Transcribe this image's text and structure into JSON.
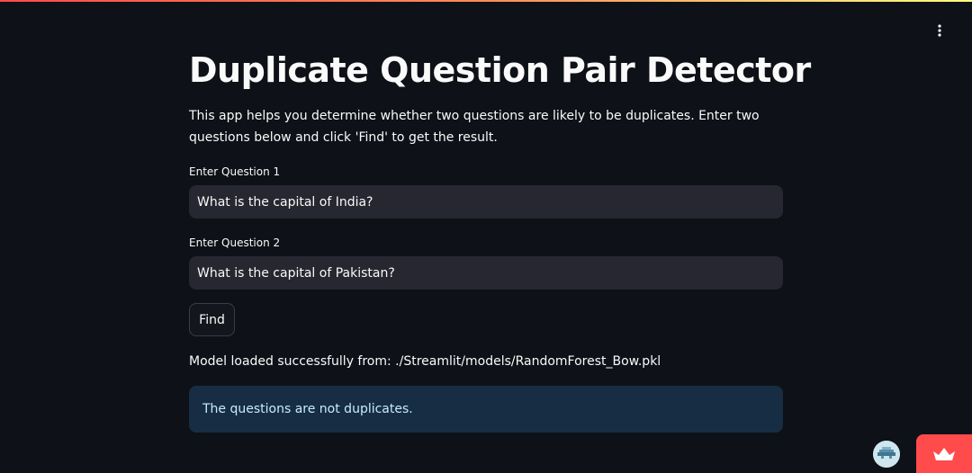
{
  "header": {
    "menu_icon": "kebab-menu-icon",
    "accent_gradient": [
      "#ff4b4b",
      "#ff8c5a",
      "#fffd80"
    ]
  },
  "main": {
    "title": "Duplicate Question Pair Detector",
    "description": "This app helps you determine whether two questions are likely to be duplicates. Enter two questions below and click 'Find' to get the result.",
    "question1": {
      "label": "Enter Question 1",
      "value": "What is the capital of India?"
    },
    "question2": {
      "label": "Enter Question 2",
      "value": "What is the capital of Pakistan?"
    },
    "find_button": "Find",
    "status_message": "Model loaded successfully from: ./Streamlit/models/RandomForest_Bow.pkl",
    "result_message": "The questions are not duplicates."
  },
  "footer": {
    "avatar_icon": "user-avatar-icon",
    "badge_icon": "streamlit-crown-icon",
    "badge_color": "#ff4b4b"
  },
  "colors": {
    "background": "#0e1117",
    "input_bg": "#262730",
    "info_bg": "#172d43",
    "info_text": "#c7ebff"
  }
}
